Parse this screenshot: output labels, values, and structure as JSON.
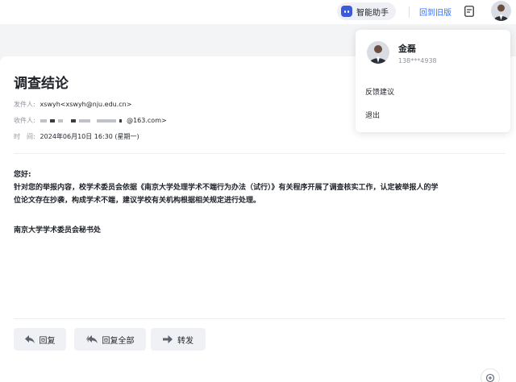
{
  "topbar": {
    "assistant_label": "智能助手",
    "old_version_link": "回到旧版",
    "accent_color": "#3370ff"
  },
  "mail": {
    "title": "调查结论",
    "from_label": "发件人:",
    "from_value": "xswyh<xswyh@nju.edu.cn>",
    "to_label": "收件人:",
    "to_value_visible": "@163.com>",
    "time_label": "时　间:",
    "time_value": "2024年06月10日 16:30 (星期一)",
    "greeting": "您好:",
    "body_line1": "针对您的举报内容，校学术委员会依据《南京大学处理学术不端行为办法（试行）》有关程序开展了调查核实工作，认定被举报人的学",
    "body_line2": "位论文存在抄袭，构成学术不端，建议学校有关机构根据相关规定进行处理。",
    "signature": "南京大学学术委员会秘书处"
  },
  "actions": {
    "reply": "回复",
    "reply_all": "回复全部",
    "forward": "转发"
  },
  "user_menu": {
    "name": "金磊",
    "phone": "138***4938",
    "feedback": "反馈建议",
    "logout": "退出"
  },
  "icons": {
    "assistant": "robot-icon",
    "note": "note-icon",
    "reply": "reply-icon",
    "reply_all": "reply-all-icon",
    "forward": "forward-icon",
    "zoom": "zoom-icon"
  }
}
